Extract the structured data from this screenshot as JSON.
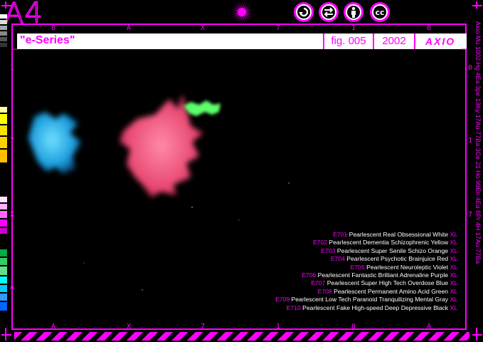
{
  "header": {
    "logo": "A4",
    "title": "\"e-Series\"",
    "figure": "fig. 005",
    "year": "2002",
    "brand": "AXIO"
  },
  "license_icons": [
    "cc-remix-icon",
    "cc-share-icon",
    "cc-attribution-icon",
    "cc-icon"
  ],
  "license_labels": {
    "cc": "cc"
  },
  "ruler_top": [
    "0",
    "A",
    "X",
    "7",
    "1",
    "0"
  ],
  "ruler_bottom": [
    "A",
    "X",
    "7",
    "1",
    "0",
    "A"
  ],
  "side_left": [
    "1",
    "7",
    "X",
    "A"
  ],
  "side_right": [
    "0",
    "1",
    "7"
  ],
  "legend": [
    {
      "code": "E701",
      "name": "Pearlescent Real Obsessional White",
      "size": "XL"
    },
    {
      "code": "E702",
      "name": "Pearlescent Dementia Schizophrenic Yellow",
      "size": "XL"
    },
    {
      "code": "E703",
      "name": "Pearlescent Super Senile Schizo Orange",
      "size": "XL"
    },
    {
      "code": "E704",
      "name": "Pearlescent Psychotic Brainjuice Red",
      "size": "XL"
    },
    {
      "code": "E705",
      "name": "Pearlescent Neuroleptic Violet",
      "size": "XL"
    },
    {
      "code": "E706",
      "name": "Pearlescent Fantastic Brilliant Adrenaline Purple",
      "size": "XL"
    },
    {
      "code": "E707",
      "name": "Pearlescent Super High Tech Overdose Blue",
      "size": "XL"
    },
    {
      "code": "E708",
      "name": "Pearlescent Permanent Amino Acid Green",
      "size": "XL"
    },
    {
      "code": "E709",
      "name": "Pearlescent Low Tech Paranoid Tranquilizing Mental Gray",
      "size": "XL"
    },
    {
      "code": "E710",
      "name": "Pearlescent Fake High-speed Deep Depressive Black",
      "size": "XL"
    }
  ],
  "right_vertical_text": "Axio Mu 1002 Hg 4Ea 3pe 13Ky 17Au 77Ba 3Ce 21 Ho 99En 4Ea 8Pr 4H 17Au 77Ba",
  "colors": {
    "accent": "#ff00ff",
    "blue_blob": "#1fb6ff",
    "pink_blob": "#ff4f7a",
    "green_blob": "#5dff6a"
  }
}
